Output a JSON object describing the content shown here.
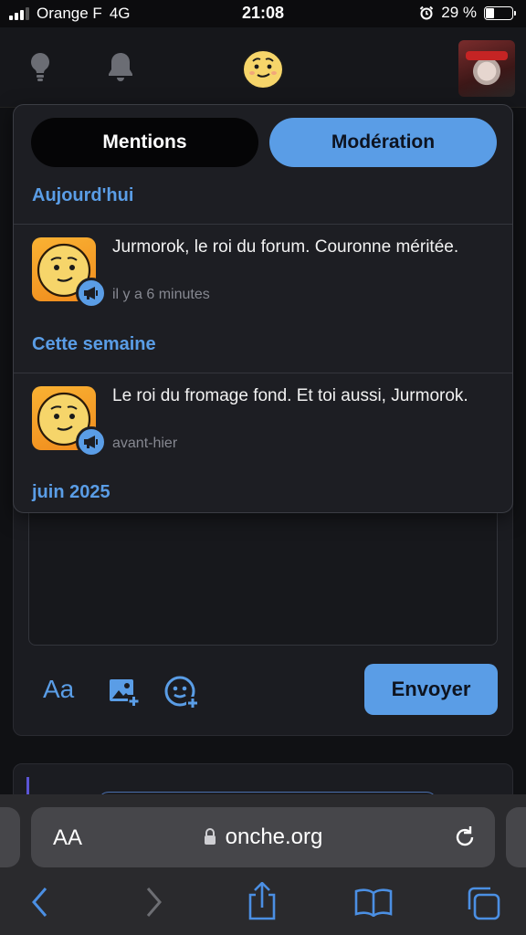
{
  "status_bar": {
    "carrier": "Orange F",
    "network": "4G",
    "time": "21:08",
    "battery": "29 %"
  },
  "compose": {
    "send_label": "Envoyer",
    "font_tool_label": "Aa"
  },
  "notifications": {
    "tabs": {
      "mentions": "Mentions",
      "moderation": "Modération"
    },
    "sections": [
      {
        "title": "Aujourd'hui",
        "items": [
          {
            "text": "Jurmorok, le roi du forum. Couronne méritée.",
            "time": "il y a 6 minutes"
          }
        ]
      },
      {
        "title": "Cette semaine",
        "items": [
          {
            "text": "Le roi du fromage fond. Et toi aussi, Jurmorok.",
            "time": "avant-hier"
          }
        ]
      },
      {
        "title": "juin 2025",
        "items": []
      }
    ]
  },
  "browser": {
    "url": "onche.org",
    "aa": "AA"
  },
  "colors": {
    "accent": "#5a9de6",
    "panel": "#1d1e23",
    "background": "#101114"
  },
  "icons": [
    "lightbulb-icon",
    "bell-icon",
    "smiley-logo-icon",
    "image-add-icon",
    "emoji-add-icon",
    "megaphone-icon",
    "lock-icon",
    "reload-icon",
    "back-icon",
    "forward-icon",
    "share-icon",
    "bookmarks-icon",
    "tabs-icon"
  ]
}
